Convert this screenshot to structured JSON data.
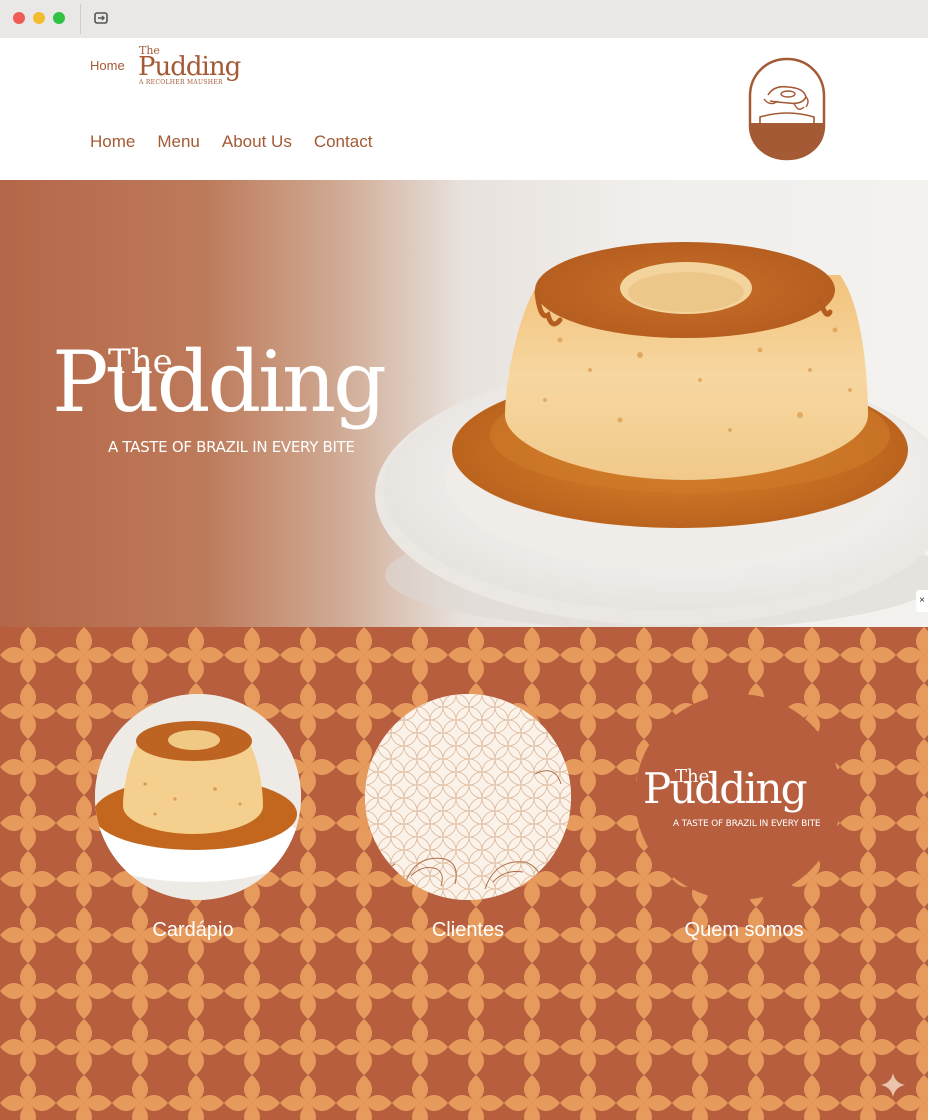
{
  "header": {
    "breadcrumb_home": "Home",
    "mini_logo": {
      "the": "The",
      "word": "Pudding",
      "tagline": "A RECOLHER MAUSHER"
    },
    "nav": [
      {
        "label": "Home"
      },
      {
        "label": "Menu"
      },
      {
        "label": "About Us"
      },
      {
        "label": "Contact"
      }
    ]
  },
  "hero": {
    "logo_the": "The",
    "logo_word": "Pudding",
    "tagline": "A TASTE OF BRAZIL IN EVERY BITE",
    "edge_marker": "×"
  },
  "cards": [
    {
      "caption": "Cardápio"
    },
    {
      "caption": "Clientes"
    },
    {
      "caption": "Quem somos",
      "logo_the": "The",
      "logo_word": "Pudding",
      "logo_tagline": "A TASTE OF BRAZIL IN EVERY BITE"
    }
  ],
  "colors": {
    "brand": "#a35a35",
    "terracotta": "#b65e3d",
    "pattern_light": "#e69a5c",
    "white": "#ffffff"
  },
  "icons": [
    "reload-icon",
    "pudding-badge-icon",
    "sparkle-icon"
  ]
}
